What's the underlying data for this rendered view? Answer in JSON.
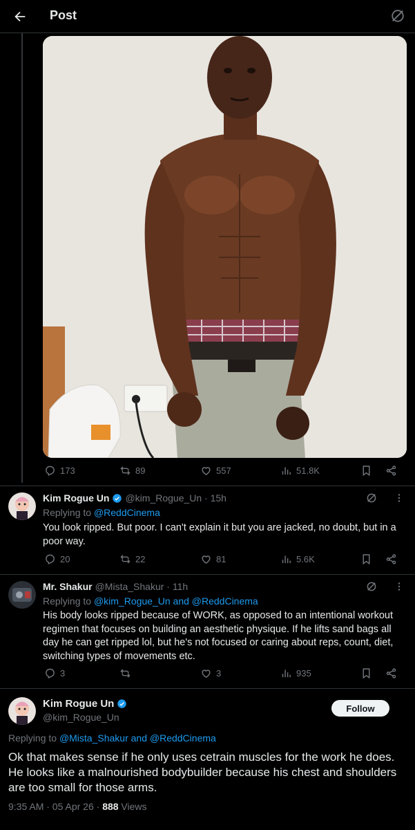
{
  "header": {
    "title": "Post"
  },
  "post_stats": {
    "replies": "173",
    "reposts": "89",
    "likes": "557",
    "views": "51.8K"
  },
  "replies": [
    {
      "name": "Kim Rogue Un",
      "handle": "@kim_Rogue_Un · 15h",
      "replying_prefix": "Replying to ",
      "replying_to": "@ReddCinema",
      "text": "You look ripped. But poor. I can't explain it but you are jacked, no doubt,  but in a poor way.",
      "stats": {
        "replies": "20",
        "reposts": "22",
        "likes": "81",
        "views": "5.6K"
      }
    },
    {
      "name": "Mr. Shakur",
      "handle": "@Mista_Shakur · 11h",
      "replying_prefix": "Replying to ",
      "replying_to": "@kim_Rogue_Un and @ReddCinema",
      "text": "His body looks ripped because of WORK, as opposed to an intentional workout regimen that focuses on building an aesthetic physique. If he lifts sand bags all day he can get ripped lol, but he's not focused or caring about reps, count, diet, switching types of movements etc.",
      "stats": {
        "replies": "3",
        "reposts": "",
        "likes": "3",
        "views": "935"
      }
    }
  ],
  "main_tweet": {
    "name": "Kim Rogue Un",
    "handle": "@kim_Rogue_Un",
    "follow_label": "Follow",
    "replying_prefix": "Replying to ",
    "replying_to": "@Mista_Shakur and @ReddCinema",
    "text": "Ok that makes sense if he only uses cetrain muscles for the work he does. He looks like a malnourished bodybuilder because his chest and shoulders are too small for those arms.",
    "time": "9:35 AM · 05 Apr 26 · ",
    "views_count": "888",
    "views_label": " Views"
  },
  "colors": {
    "background": "#000000",
    "accent": "#1d9bf0",
    "muted": "#71767b",
    "text": "#e7e9ea",
    "border": "#2f3336"
  },
  "icons": [
    "back-arrow-icon",
    "grok-icon",
    "reply-icon",
    "repost-icon",
    "like-icon",
    "views-icon",
    "bookmark-icon",
    "share-icon",
    "more-icon",
    "verified-icon"
  ]
}
